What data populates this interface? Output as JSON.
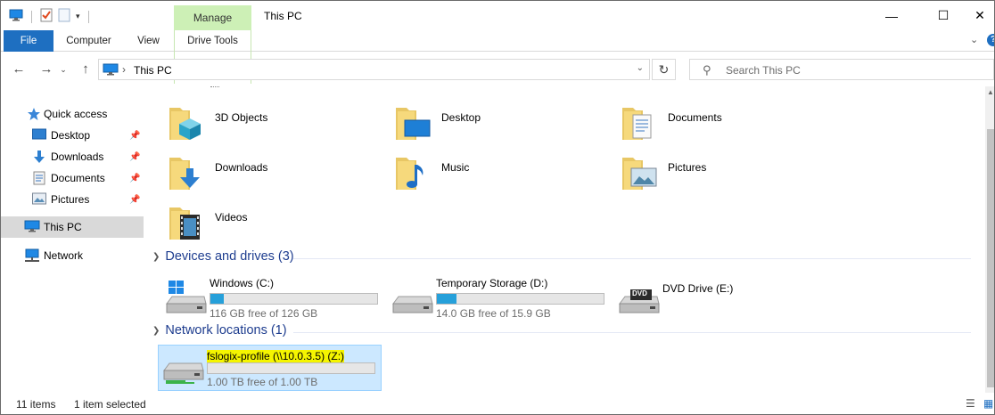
{
  "window": {
    "title": "This PC",
    "manage_tab": "Manage",
    "minimize": "—",
    "maximize": "☐",
    "close": "✕"
  },
  "ribbon": {
    "tabs": [
      "File",
      "Computer",
      "View",
      "Drive Tools"
    ],
    "collapse_glyph": "⌄",
    "help_glyph": "?"
  },
  "address": {
    "path": "This PC",
    "search_placeholder": "Search This PC"
  },
  "nav_pane": {
    "items": [
      {
        "label": "Quick access",
        "icon": "star-icon",
        "pinned": false
      },
      {
        "label": "Desktop",
        "icon": "desktop-icon",
        "pinned": true
      },
      {
        "label": "Downloads",
        "icon": "download-arrow-icon",
        "pinned": true
      },
      {
        "label": "Documents",
        "icon": "documents-icon",
        "pinned": true
      },
      {
        "label": "Pictures",
        "icon": "pictures-icon",
        "pinned": true
      },
      {
        "label": "This PC",
        "icon": "this-pc-icon",
        "pinned": false,
        "selected": true
      },
      {
        "label": "Network",
        "icon": "network-icon",
        "pinned": false
      }
    ]
  },
  "folders": [
    {
      "name": "3D Objects",
      "icon": "3d-objects-folder-icon"
    },
    {
      "name": "Desktop",
      "icon": "desktop-folder-icon"
    },
    {
      "name": "Documents",
      "icon": "documents-folder-icon"
    },
    {
      "name": "Downloads",
      "icon": "downloads-folder-icon"
    },
    {
      "name": "Music",
      "icon": "music-folder-icon"
    },
    {
      "name": "Pictures",
      "icon": "pictures-folder-icon"
    },
    {
      "name": "Videos",
      "icon": "videos-folder-icon"
    }
  ],
  "groups": {
    "devices": "Devices and drives (3)",
    "network": "Network locations (1)"
  },
  "drives": [
    {
      "name": "Windows (C:)",
      "free": "116 GB free of 126 GB",
      "used_fraction": 0.08,
      "icon": "windows-drive-icon"
    },
    {
      "name": "Temporary Storage (D:)",
      "free": "14.0 GB free of 15.9 GB",
      "used_fraction": 0.12,
      "icon": "hard-drive-icon"
    },
    {
      "name": "DVD Drive (E:)",
      "free": "",
      "icon": "dvd-drive-icon"
    }
  ],
  "network_locations": [
    {
      "name": "fslogix-profile (\\\\10.0.3.5) (Z:)",
      "free": "1.00 TB free of 1.00 TB",
      "used_fraction": 0.0,
      "icon": "network-drive-icon",
      "selected": true
    }
  ],
  "status": {
    "items": "11 items",
    "selected": "1 item selected"
  },
  "colors": {
    "accent": "#1e6fc1",
    "manage_tab": "#cdf0b6",
    "group_header": "#1e3d8f",
    "drive_bar": "#26a0da",
    "selection": "#cce8ff",
    "highlight": "#f5f500"
  }
}
